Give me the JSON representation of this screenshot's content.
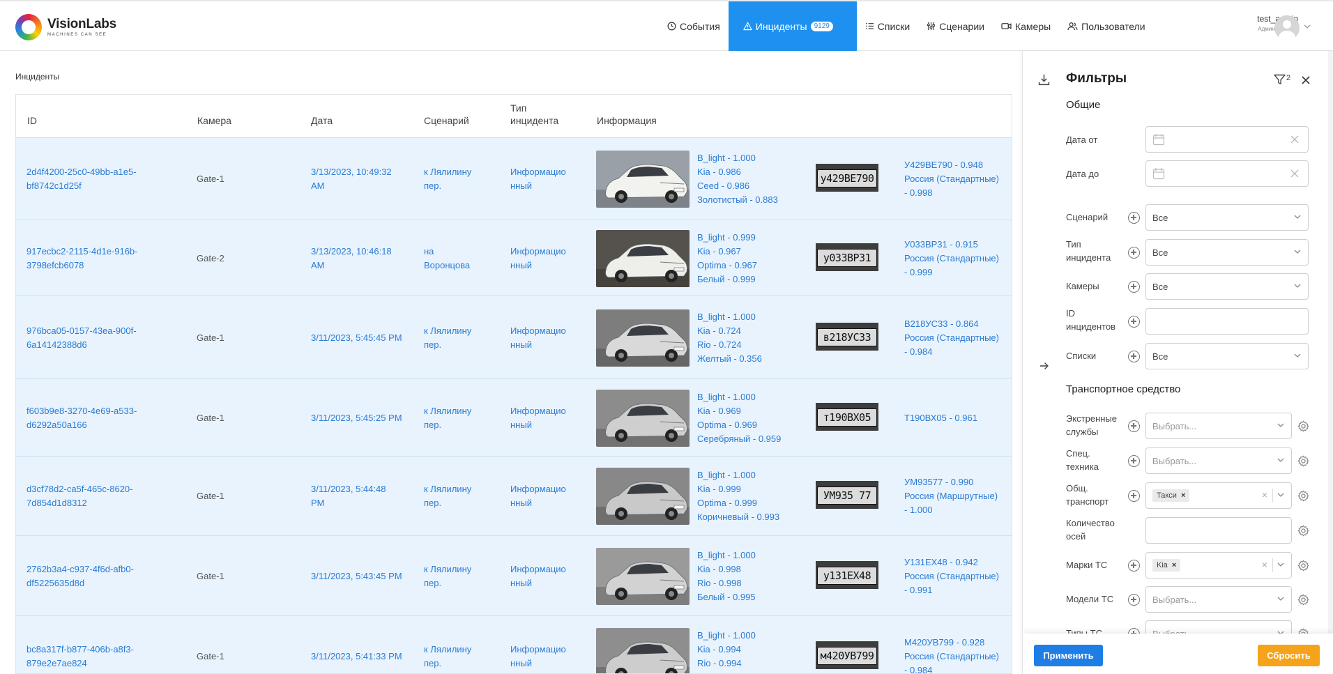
{
  "brand": {
    "name": "VisionLabs",
    "tagline": "MACHINES CAN SEE"
  },
  "nav": {
    "events": "События",
    "incidents": "Инциденты",
    "incidents_count": "9129",
    "lists": "Списки",
    "scenarios": "Сценарии",
    "cameras": "Камеры",
    "users": "Пользователи"
  },
  "user": {
    "name": "test_admin",
    "role": "Администратор"
  },
  "breadcrumb": "Инциденты",
  "table": {
    "headers": {
      "id": "ID",
      "camera": "Камера",
      "date": "Дата",
      "scenario": "Сценарий",
      "type_line1": "Тип",
      "type_line2": "инцидента",
      "info": "Информация"
    },
    "rows": [
      {
        "id1": "2d4f4200-25c0-49bb-a1e5-",
        "id2": "bf8742c1d25f",
        "camera": "Gate-1",
        "date1": "3/13/2023, 10:49:32",
        "date2": "AM",
        "sc1": "к Лялилину",
        "sc2": "пер.",
        "t1": "Информацио",
        "t2": "нный",
        "info": [
          "B_light - 1.000",
          "Kia - 0.986",
          "Ceed - 0.986",
          "Золотистый - 0.883"
        ],
        "plate_text": "у429ВЕ790",
        "plate_info": [
          "У429ВЕ790 - 0.948",
          "Россия (Стандартные)",
          "- 0.998"
        ]
      },
      {
        "id1": "917ecbc2-2115-4d1e-916b-",
        "id2": "3798efcb6078",
        "camera": "Gate-2",
        "date1": "3/13/2023, 10:46:18",
        "date2": "AM",
        "sc1": "на",
        "sc2": "Воронцова",
        "t1": "Информацио",
        "t2": "нный",
        "info": [
          "B_light - 0.999",
          "Kia - 0.967",
          "Optima - 0.967",
          "Белый - 0.999"
        ],
        "plate_text": "у033ВР31",
        "plate_info": [
          "У033ВР31 - 0.915",
          "Россия (Стандартные)",
          "- 0.999"
        ]
      },
      {
        "id1": "976bca05-0157-43ea-900f-",
        "id2": "6a14142388d6",
        "camera": "Gate-1",
        "date1": "3/11/2023, 5:45:45 PM",
        "date2": "",
        "sc1": "к Лялилину",
        "sc2": "пер.",
        "t1": "Информацио",
        "t2": "нный",
        "info": [
          "B_light - 1.000",
          "Kia - 0.724",
          "Rio - 0.724",
          "Желтый - 0.356"
        ],
        "plate_text": "в218УС33",
        "plate_info": [
          "В218УС33 - 0.864",
          "Россия (Стандартные)",
          "- 0.984"
        ]
      },
      {
        "id1": "f603b9e8-3270-4e69-a533-",
        "id2": "d6292a50a166",
        "camera": "Gate-1",
        "date1": "3/11/2023, 5:45:25 PM",
        "date2": "",
        "sc1": "к Лялилину",
        "sc2": "пер.",
        "t1": "Информацио",
        "t2": "нный",
        "info": [
          "B_light - 1.000",
          "Kia - 0.969",
          "Optima - 0.969",
          "Серебряный - 0.959"
        ],
        "plate_text": "т190ВХ05",
        "plate_info": [
          "Т190ВХ05 - 0.961"
        ]
      },
      {
        "id1": "d3cf78d2-ca5f-465c-8620-",
        "id2": "7d854d1d8312",
        "camera": "Gate-1",
        "date1": "3/11/2023, 5:44:48",
        "date2": "PM",
        "sc1": "к Лялилину",
        "sc2": "пер.",
        "t1": "Информацио",
        "t2": "нный",
        "info": [
          "B_light - 1.000",
          "Kia - 0.999",
          "Optima - 0.999",
          "Коричневый - 0.993"
        ],
        "plate_text": "УМ935 77",
        "plate_info": [
          "УМ93577 - 0.990",
          "Россия (Маршрутные)",
          "- 1.000"
        ]
      },
      {
        "id1": "2762b3a4-c937-4f6d-afb0-",
        "id2": "df5225635d8d",
        "camera": "Gate-1",
        "date1": "3/11/2023, 5:43:45 PM",
        "date2": "",
        "sc1": "к Лялилину",
        "sc2": "пер.",
        "t1": "Информацио",
        "t2": "нный",
        "info": [
          "B_light - 1.000",
          "Kia - 0.998",
          "Rio - 0.998",
          "Белый - 0.995"
        ],
        "plate_text": "у131ЕХ48",
        "plate_info": [
          "У131ЕХ48 - 0.942",
          "Россия (Стандартные)",
          "- 0.991"
        ]
      },
      {
        "id1": "bc8a317f-b877-406b-a8f3-",
        "id2": "879e2e7ae824",
        "camera": "Gate-1",
        "date1": "3/11/2023, 5:41:33 PM",
        "date2": "",
        "sc1": "к Лялилину",
        "sc2": "пер.",
        "t1": "Информацио",
        "t2": "нный",
        "info": [
          "B_light - 1.000",
          "Kia - 0.994",
          "Rio - 0.994",
          ""
        ],
        "plate_text": "м420УВ799",
        "plate_info": [
          "М420УВ799 - 0.928",
          "Россия (Стандартные)",
          "- 0.984"
        ]
      }
    ]
  },
  "filters": {
    "title": "Фильтры",
    "active_count": "2",
    "general": "Общие",
    "date_from": "Дата от",
    "date_to": "Дата до",
    "scenario": "Сценарий",
    "type1": "Тип",
    "type2": "инцидента",
    "cameras": "Камеры",
    "ids1": "ID",
    "ids2": "инцидентов",
    "lists": "Списки",
    "all": "Все",
    "vehicle": "Транспортное средство",
    "emergency1": "Экстренные",
    "emergency2": "службы",
    "special1": "Спец.",
    "special2": "техника",
    "public1": "Общ.",
    "public2": "транспорт",
    "axles1": "Количество",
    "axles2": "осей",
    "brands": "Марки ТС",
    "models": "Модели ТС",
    "types": "Типы ТС",
    "choose": "Выбрать...",
    "chip_taxi": "Такси",
    "chip_kia": "Kia",
    "apply": "Применить",
    "reset": "Сбросить"
  },
  "colors": {
    "accent": "#1e90f0",
    "row_bg": "#e8f3fd",
    "link": "#2a7bd4",
    "reset": "#f5a31a"
  }
}
